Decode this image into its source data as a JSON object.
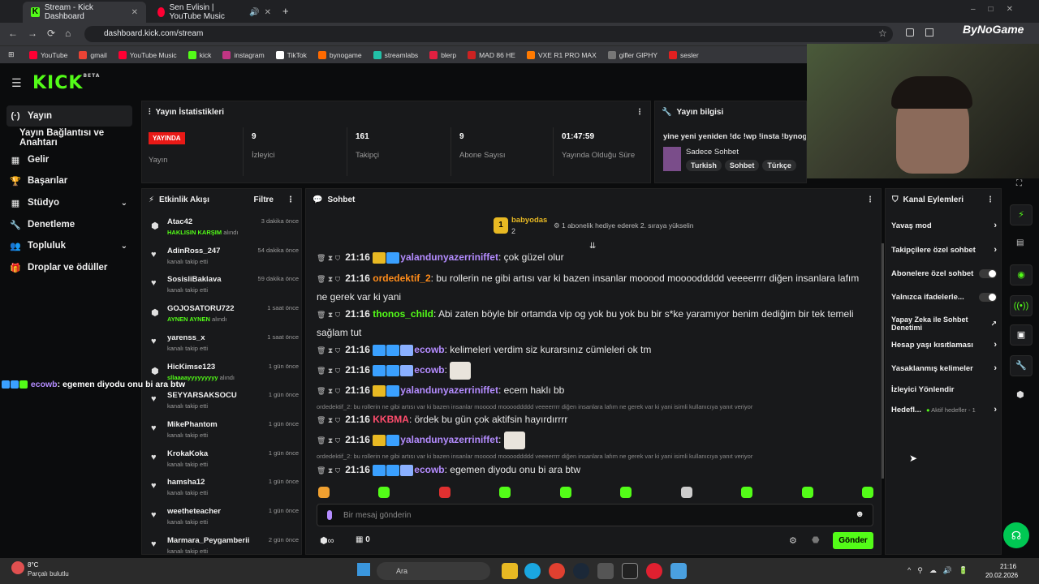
{
  "browser": {
    "tabs": [
      {
        "label": "Stream - Kick Dashboard"
      },
      {
        "label": "Sen Evlisin | YouTube Music"
      }
    ],
    "url": "dashboard.kick.com/stream",
    "bookmarks": [
      "YouTube",
      "gmail",
      "YouTube Music",
      "kick",
      "instagram",
      "TikTok",
      "bynogame",
      "streamlabs",
      "blerp",
      "MAD 86 HE",
      "VXE R1 PRO MAX",
      "gifler GIPHY",
      "sesler"
    ],
    "bynogame_logo": "ByNoGame"
  },
  "app": {
    "logo": "KICK",
    "logo_tag": "BETA"
  },
  "sidebar": {
    "items": [
      {
        "label": "Yayın",
        "icon": "broadcast-icon"
      },
      {
        "label": "Yayın Bağlantısı ve Anahtarı"
      },
      {
        "label": "Gelir",
        "icon": "revenue-icon"
      },
      {
        "label": "Başarılar",
        "icon": "trophy-icon"
      },
      {
        "label": "Stüdyo",
        "icon": "studio-icon"
      },
      {
        "label": "Denetleme",
        "icon": "wrench-icon"
      },
      {
        "label": "Topluluk",
        "icon": "people-icon"
      },
      {
        "label": "Droplar ve ödüller",
        "icon": "gift-icon"
      }
    ]
  },
  "stats": {
    "title": "Yayın İstatistikleri",
    "status_badge": "YAYINDA",
    "status_label": "Yayın",
    "items": [
      {
        "value": "9",
        "label": "İzleyici"
      },
      {
        "value": "161",
        "label": "Takipçi"
      },
      {
        "value": "9",
        "label": "Abone Sayısı"
      },
      {
        "value": "01:47:59",
        "label": "Yayında Olduğu Süre"
      }
    ]
  },
  "info": {
    "title": "Yayın bilgisi",
    "stream_title": "yine yeni yeniden !dc !wp !insta !bynog",
    "category": "Sadece Sohbet",
    "tags": [
      "Turkish",
      "Sohbet",
      "Türkçe"
    ]
  },
  "activity": {
    "title": "Etkinlik Akışı",
    "filter": "Filtre",
    "items": [
      {
        "name": "Atac42",
        "desc_bold": "HAKLISIN KARŞIM",
        "desc": "alındı",
        "time": "3 dakika önce",
        "icon": "reward-icon"
      },
      {
        "name": "AdinRoss_247",
        "desc": "kanalı takip etti",
        "time": "54 dakika önce",
        "icon": "heart-icon"
      },
      {
        "name": "SosisliBaklava",
        "desc": "kanalı takip etti",
        "time": "59 dakika önce",
        "icon": "heart-icon"
      },
      {
        "name": "GOJOSATORU722",
        "desc_bold": "AYNEN AYNEN",
        "desc": "alındı",
        "time": "1 saat önce",
        "icon": "reward-icon"
      },
      {
        "name": "yarenss_x",
        "desc": "kanalı takip etti",
        "time": "1 saat önce",
        "icon": "heart-icon"
      },
      {
        "name": "HicKimse123",
        "desc_bold": "sllaaaayyyyyyyyy",
        "desc": "alındı",
        "time": "1 gün önce",
        "icon": "reward-icon"
      },
      {
        "name": "SEYYARSAKSOCU",
        "desc": "kanalı takip etti",
        "time": "1 gün önce",
        "icon": "heart-icon"
      },
      {
        "name": "MikePhantom",
        "desc": "kanalı takip etti",
        "time": "1 gün önce",
        "icon": "heart-icon"
      },
      {
        "name": "KrokaKoka",
        "desc": "kanalı takip etti",
        "time": "1 gün önce",
        "icon": "heart-icon"
      },
      {
        "name": "hamsha12",
        "desc": "kanalı takip etti",
        "time": "1 gün önce",
        "icon": "heart-icon"
      },
      {
        "name": "weetheteacher",
        "desc": "kanalı takip etti",
        "time": "1 gün önce",
        "icon": "heart-icon"
      },
      {
        "name": "Marmara_Peygamberii",
        "desc": "kanalı takip etti",
        "time": "2 gün önce",
        "icon": "heart-icon"
      }
    ]
  },
  "overlay_message": {
    "user": "ecowb",
    "text": ": egemen diyodu onu bi ara btw"
  },
  "chat": {
    "title": "Sohbet",
    "gift": {
      "user": "babyodas",
      "count": "2",
      "text": "1 abonelik hediye ederek 2. sıraya yükselin"
    },
    "messages": [
      {
        "time": "21:16",
        "user": "yalandunyazerriniffet",
        "color": "#b48cff",
        "text": ": çok güzel olur"
      },
      {
        "time": "21:16",
        "user": "ordedektif_2",
        "color": "#ff8c1a",
        "text": ": bu rollerin ne gibi artısı var ki bazen insanlar mooood mooooddddd veeeerrrr diğen insanlara lafım ne gerek var ki yani"
      },
      {
        "time": "21:16",
        "user": "thonos_child",
        "color": "#53fc18",
        "text": ": Abi zaten böyle bir ortamda vip og yok bu yok bu bir s*ke yaramıyor benim dediğim bir tek temeli sağlam tut"
      },
      {
        "time": "21:16",
        "user": "ecowb",
        "color": "#b48cff",
        "text": ": kelimeleri verdim siz kurarsınız cümleleri ok tm"
      },
      {
        "time": "21:16",
        "user": "ecowb",
        "color": "#b48cff",
        "text": ":"
      },
      {
        "time": "21:16",
        "user": "yalandunyazerriniffet",
        "color": "#b48cff",
        "text": ": ecem haklı bb"
      },
      {
        "time": "21:16",
        "user": "KKBMA",
        "color": "#ff4d6d",
        "text": ": ördek bu gün çok aktifsin hayırdırrrr"
      },
      {
        "time": "21:16",
        "user": "yalandunyazerriniffet",
        "color": "#b48cff",
        "text": ":"
      },
      {
        "time": "21:16",
        "user": "ecowb",
        "color": "#b48cff",
        "text": ": egemen diyodu onu bi ara btw"
      }
    ],
    "replies": [
      "ordedektif_2: bu rollerin ne gibi artısı var ki bazen insanlar mooood mooooddddd veeeerrrr diğen insanlara lafım ne gerek var ki yani isimli kullanıcıya yanıt veriyor",
      "ordedektif_2: bu rollerin ne gibi artısı var ki bazen insanlar mooood mooooddddd veeeerrrr diğen insanlara lafım ne gerek var ki yani isimli kullanıcıya yanıt veriyor"
    ],
    "placeholder": "Bir mesaj gönderin",
    "points": "0",
    "send": "Gönder"
  },
  "channel_actions": {
    "title": "Kanal Eylemleri",
    "items": [
      {
        "label": "Yavaş mod",
        "type": "chevron"
      },
      {
        "label": "Takipçilere özel sohbet",
        "type": "chevron"
      },
      {
        "label": "Abonelere özel sohbet",
        "type": "toggle"
      },
      {
        "label": "Yalnızca ifadelerle...",
        "type": "toggle"
      },
      {
        "label": "Yapay Zeka ile Sohbet Denetimi",
        "type": "external"
      },
      {
        "label": "Hesap yaşı kısıtlaması",
        "type": "chevron"
      },
      {
        "label": "Yasaklanmış kelimeler",
        "type": "chevron"
      },
      {
        "label": "İzleyici Yönlendir",
        "type": "none"
      },
      {
        "label": "Hedefl...",
        "type": "chevron",
        "extra": "Aktif hedefler - 1"
      }
    ]
  },
  "taskbar": {
    "weather_temp": "8°C",
    "weather_desc": "Parçalı bulutlu",
    "search": "Ara",
    "time": "21:16",
    "date": "20.02.2026"
  },
  "colors": {
    "accent": "#53fc18",
    "live": "#e91916",
    "panel": "#18191b"
  }
}
